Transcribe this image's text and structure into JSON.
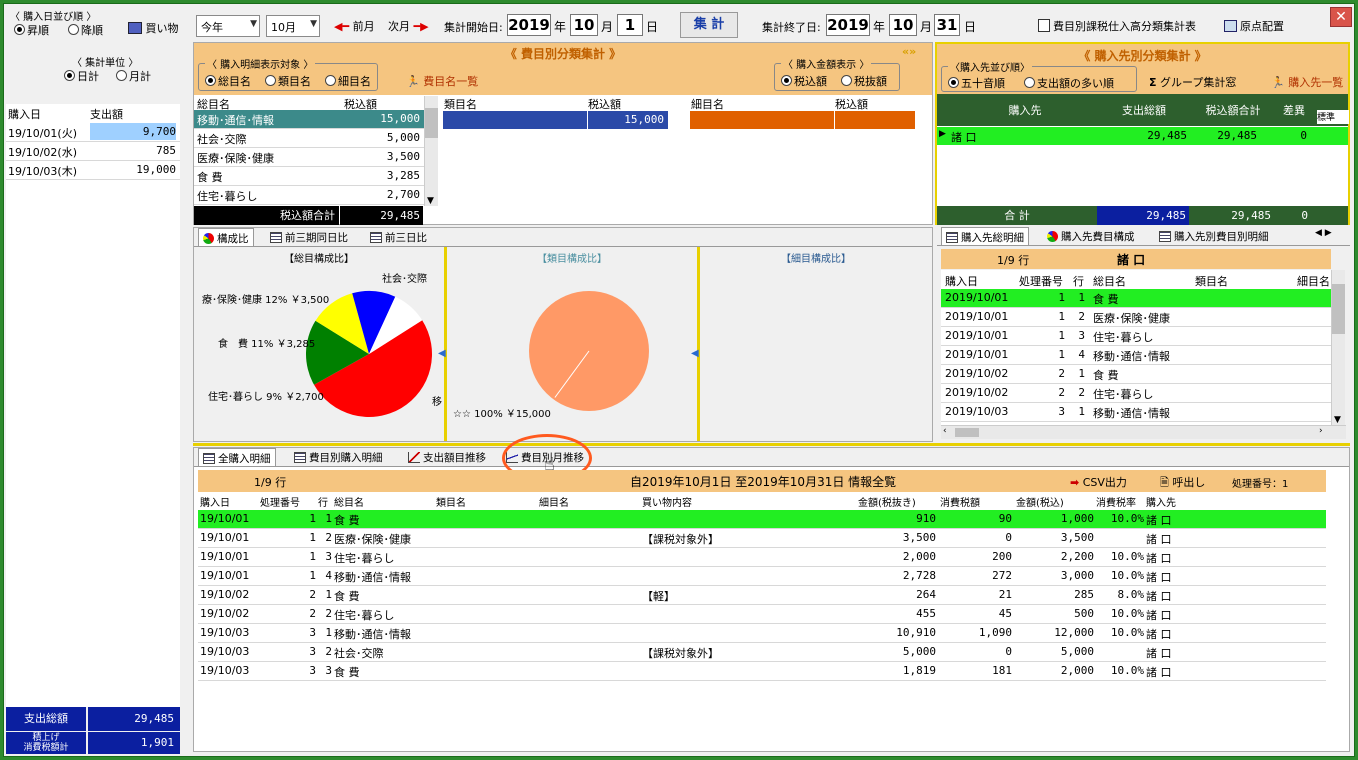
{
  "top": {
    "sort_group_label": "〈 購入日並び順 〉",
    "sort_asc": "昇順",
    "sort_desc": "降順",
    "shopping_button": "買い物",
    "period_combo": "今年",
    "month_combo": "10月",
    "prev_month": "前月",
    "next_month": "次月",
    "start_label": "集計開始日:",
    "start_year": "2019",
    "year_unit": "年",
    "start_month": "10",
    "month_unit": "月",
    "start_day": "1",
    "day_unit": "日",
    "aggregate_button": "集 計",
    "end_label": "集計終了日:",
    "end_year": "2019",
    "end_month": "10",
    "end_day": "31",
    "report_button": "費目別課税仕入高分類集計表",
    "layout_button": "原点配置"
  },
  "left": {
    "unit_group_label": "〈 集計単位 〉",
    "unit_daily": "日計",
    "unit_monthly": "月計",
    "col_date": "購入日",
    "col_amount": "支出額",
    "rows": [
      {
        "date": "19/10/01(火)",
        "amount": "9,700"
      },
      {
        "date": "19/10/02(水)",
        "amount": "785"
      },
      {
        "date": "19/10/03(木)",
        "amount": "19,000"
      }
    ],
    "total_label": "支出総額",
    "total_value": "29,485",
    "tax_label_1": "積上げ",
    "tax_label_2": "消費税額計",
    "tax_value": "1,901"
  },
  "category_panel": {
    "title": "《 費目別分類集計 》",
    "detail_group_label": "〈 購入明細表示対象 〉",
    "opt_sokmoku": "総目名",
    "opt_ruimoku": "類目名",
    "opt_saimoku": "細目名",
    "list_button": "費目名一覧",
    "amount_group_label": "〈 購入金額表示 〉",
    "opt_tax_in": "税込額",
    "opt_tax_out": "税抜額",
    "col_sokmoku": "総目名",
    "col_zeikomi": "税込額",
    "col_ruimoku": "類目名",
    "col_zeikomi2": "税込額",
    "col_saimoku": "細目名",
    "col_zeikomi3": "税込額",
    "rows": [
      {
        "name": "移動･通信･情報",
        "value": "15,000"
      },
      {
        "name": "社会･交際",
        "value": "5,000"
      },
      {
        "name": "医療･保険･健康",
        "value": "3,500"
      },
      {
        "name": "食 費",
        "value": "3,285"
      },
      {
        "name": "住宅･暮らし",
        "value": "2,700"
      }
    ],
    "total_label": "税込額合計",
    "total_value": "29,485",
    "ruimoku_value": "15,000"
  },
  "charts": {
    "tab1": "構成比",
    "tab2": "前三期同日比",
    "tab3": "前三日比",
    "title1": "【総目構成比】",
    "title2": "【類目構成比】",
    "title3": "【細目構成比】",
    "label_shakai": "社会･交際",
    "label_iryo": "療･保険･健康 12% ￥3,500",
    "label_shokuhi": "食　費 11% ￥3,285",
    "label_jutaku": "住宅･暮らし 9% ￥2,700",
    "label_ido": "移",
    "label_rui": "☆☆ 100% ￥15,000"
  },
  "chart_data": [
    {
      "type": "pie",
      "title": "【総目構成比】",
      "categories": [
        "移動･通信･情報",
        "社会･交際",
        "医療･保険･健康",
        "食 費",
        "住宅･暮らし"
      ],
      "values": [
        15000,
        5000,
        3500,
        3285,
        2700
      ],
      "colors": [
        "#ff0000",
        "#008000",
        "#ffff00",
        "#0000ff",
        "#ffffff"
      ]
    },
    {
      "type": "pie",
      "title": "【類目構成比】",
      "categories": [
        "☆☆"
      ],
      "values": [
        15000
      ],
      "colors": [
        "#ff9966"
      ]
    }
  ],
  "vendor_panel": {
    "title": "《 購入先別分類集計 》",
    "order_group_label": "〈購入先並び順〉",
    "opt_gojuon": "五十音順",
    "opt_amount": "支出額の多い順",
    "group_button": "グループ集計窓",
    "list_button": "購入先一覧",
    "col_vendor": "購入先",
    "col_total": "支出総額",
    "col_tax_total": "税込額合計",
    "col_diff": "差異",
    "col_extra": "標準",
    "row_name": "諸 口",
    "row_total": "29,485",
    "row_tax_total": "29,485",
    "row_diff": "0",
    "sum_label": "合 計",
    "sum_total": "29,485",
    "sum_tax_total": "29,485",
    "sum_diff": "0"
  },
  "vendor_detail": {
    "tab1": "購入先総明細",
    "tab2": "購入先費目構成",
    "tab3": "購入先別費目別明細",
    "count": "1/9 行",
    "vendor": "諸 口",
    "col_date": "購入日",
    "col_no": "処理番号",
    "col_line": "行",
    "col_soumoku": "総目名",
    "col_ruimoku": "類目名",
    "col_saimoku": "細目名",
    "rows": [
      {
        "date": "2019/10/01",
        "no": "1",
        "line": "1",
        "name": "食 費"
      },
      {
        "date": "2019/10/01",
        "no": "1",
        "line": "2",
        "name": "医療･保険･健康"
      },
      {
        "date": "2019/10/01",
        "no": "1",
        "line": "3",
        "name": "住宅･暮らし"
      },
      {
        "date": "2019/10/01",
        "no": "1",
        "line": "4",
        "name": "移動･通信･情報"
      },
      {
        "date": "2019/10/02",
        "no": "2",
        "line": "1",
        "name": "食 費"
      },
      {
        "date": "2019/10/02",
        "no": "2",
        "line": "2",
        "name": "住宅･暮らし"
      },
      {
        "date": "2019/10/03",
        "no": "3",
        "line": "1",
        "name": "移動･通信･情報"
      }
    ]
  },
  "bottom": {
    "tab1": "全購入明細",
    "tab2": "費目別購入明細",
    "tab3": "支出額目推移",
    "tab4": "費目別月推移",
    "count": "1/9 行",
    "info": "自2019年10月1日 至2019年10月31日 情報全覧",
    "csv_button": "CSV出力",
    "recall_button": "呼出し",
    "proc_no": "処理番号：1",
    "columns": [
      "購入日",
      "処理番号",
      "行",
      "総目名",
      "類目名",
      "細目名",
      "買い物内容",
      "金額(税抜き)",
      "消費税額",
      "金額(税込)",
      "消費税率",
      "購入先"
    ],
    "rows": [
      [
        "19/10/01",
        "1",
        "1",
        "食 費",
        "",
        "",
        "",
        "910",
        "90",
        "1,000",
        "10.0%",
        "諸 口"
      ],
      [
        "19/10/01",
        "1",
        "2",
        "医療･保険･健康",
        "",
        "",
        "【課税対象外】",
        "3,500",
        "0",
        "3,500",
        "",
        "諸 口"
      ],
      [
        "19/10/01",
        "1",
        "3",
        "住宅･暮らし",
        "",
        "",
        "",
        "2,000",
        "200",
        "2,200",
        "10.0%",
        "諸 口"
      ],
      [
        "19/10/01",
        "1",
        "4",
        "移動･通信･情報",
        "",
        "",
        "",
        "2,728",
        "272",
        "3,000",
        "10.0%",
        "諸 口"
      ],
      [
        "19/10/02",
        "2",
        "1",
        "食 費",
        "",
        "",
        "【軽】",
        "264",
        "21",
        "285",
        "8.0%",
        "諸 口"
      ],
      [
        "19/10/02",
        "2",
        "2",
        "住宅･暮らし",
        "",
        "",
        "",
        "455",
        "45",
        "500",
        "10.0%",
        "諸 口"
      ],
      [
        "19/10/03",
        "3",
        "1",
        "移動･通信･情報",
        "",
        "",
        "",
        "10,910",
        "1,090",
        "12,000",
        "10.0%",
        "諸 口"
      ],
      [
        "19/10/03",
        "3",
        "2",
        "社会･交際",
        "",
        "",
        "【課税対象外】",
        "5,000",
        "0",
        "5,000",
        "",
        "諸 口"
      ],
      [
        "19/10/03",
        "3",
        "3",
        "食 費",
        "",
        "",
        "",
        "1,819",
        "181",
        "2,000",
        "10.0%",
        "諸 口"
      ]
    ]
  }
}
